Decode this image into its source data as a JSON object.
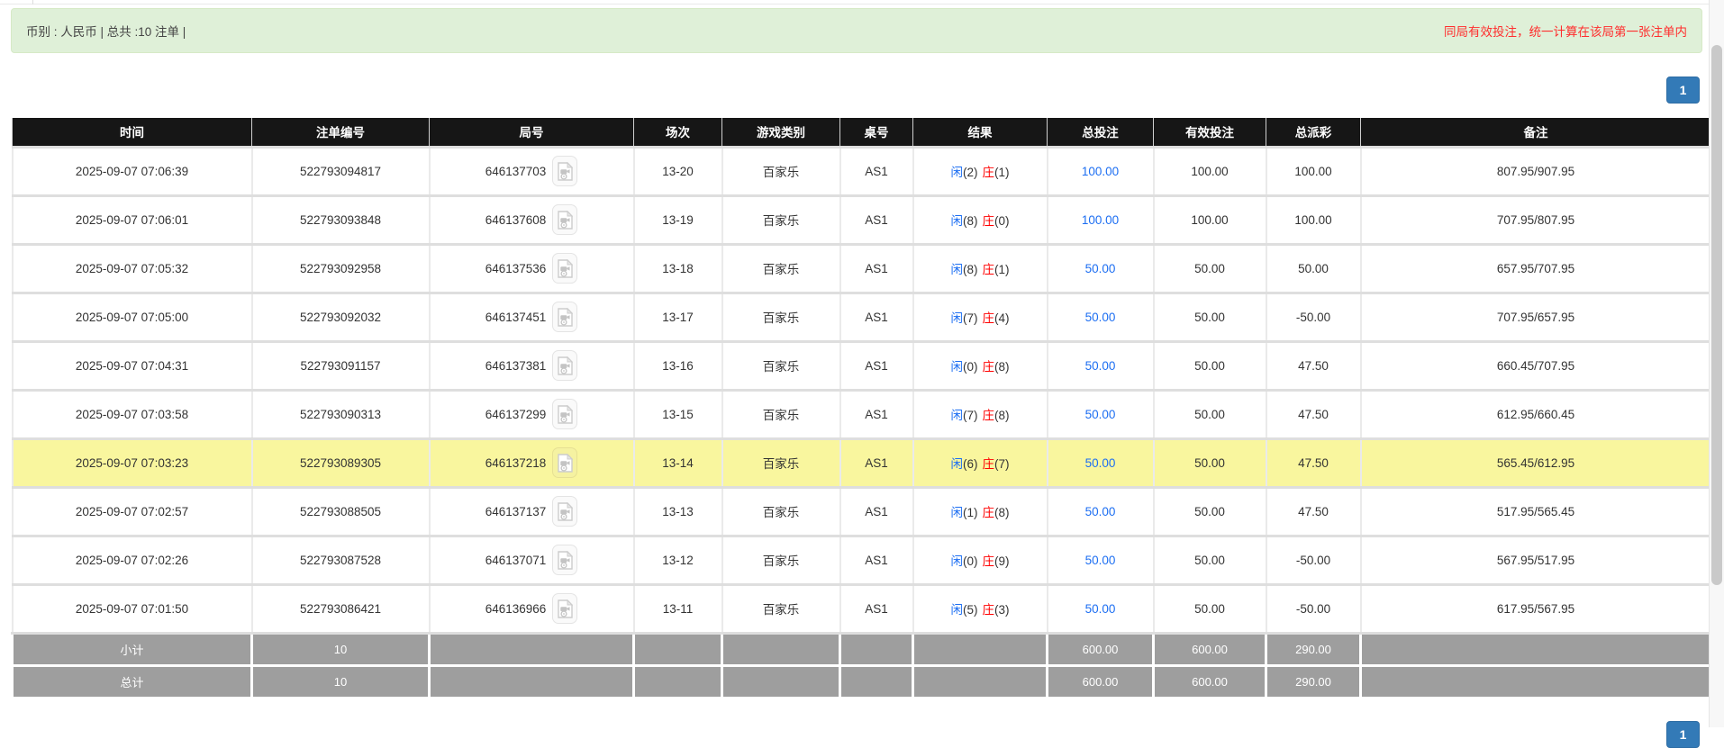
{
  "info_bar": {
    "left_text": "币别 : 人民币 | 总共 :10 注单 |",
    "right_notice": "同局有效投注，统一计算在该局第一张注单内"
  },
  "pagination": {
    "page_label": "1"
  },
  "table": {
    "headers": [
      "时间",
      "注单编号",
      "局号",
      "场次",
      "游戏类别",
      "桌号",
      "结果",
      "总投注",
      "有效投注",
      "总派彩",
      "备注"
    ],
    "rows": [
      {
        "time": "2025-09-07 07:06:39",
        "bet_no": "522793094817",
        "round_no": "646137703",
        "session": "13-20",
        "game": "百家乐",
        "table_no": "AS1",
        "player": "闲",
        "player_n": "(2)",
        "banker": "庄",
        "banker_n": "(1)",
        "total_bet": "100.00",
        "valid_bet": "100.00",
        "payout": "100.00",
        "remark": "807.95/907.95",
        "highlight": false
      },
      {
        "time": "2025-09-07 07:06:01",
        "bet_no": "522793093848",
        "round_no": "646137608",
        "session": "13-19",
        "game": "百家乐",
        "table_no": "AS1",
        "player": "闲",
        "player_n": "(8)",
        "banker": "庄",
        "banker_n": "(0)",
        "total_bet": "100.00",
        "valid_bet": "100.00",
        "payout": "100.00",
        "remark": "707.95/807.95",
        "highlight": false
      },
      {
        "time": "2025-09-07 07:05:32",
        "bet_no": "522793092958",
        "round_no": "646137536",
        "session": "13-18",
        "game": "百家乐",
        "table_no": "AS1",
        "player": "闲",
        "player_n": "(8)",
        "banker": "庄",
        "banker_n": "(1)",
        "total_bet": "50.00",
        "valid_bet": "50.00",
        "payout": "50.00",
        "remark": "657.95/707.95",
        "highlight": false
      },
      {
        "time": "2025-09-07 07:05:00",
        "bet_no": "522793092032",
        "round_no": "646137451",
        "session": "13-17",
        "game": "百家乐",
        "table_no": "AS1",
        "player": "闲",
        "player_n": "(7)",
        "banker": "庄",
        "banker_n": "(4)",
        "total_bet": "50.00",
        "valid_bet": "50.00",
        "payout": "-50.00",
        "remark": "707.95/657.95",
        "highlight": false
      },
      {
        "time": "2025-09-07 07:04:31",
        "bet_no": "522793091157",
        "round_no": "646137381",
        "session": "13-16",
        "game": "百家乐",
        "table_no": "AS1",
        "player": "闲",
        "player_n": "(0)",
        "banker": "庄",
        "banker_n": "(8)",
        "total_bet": "50.00",
        "valid_bet": "50.00",
        "payout": "47.50",
        "remark": "660.45/707.95",
        "highlight": false
      },
      {
        "time": "2025-09-07 07:03:58",
        "bet_no": "522793090313",
        "round_no": "646137299",
        "session": "13-15",
        "game": "百家乐",
        "table_no": "AS1",
        "player": "闲",
        "player_n": "(7)",
        "banker": "庄",
        "banker_n": "(8)",
        "total_bet": "50.00",
        "valid_bet": "50.00",
        "payout": "47.50",
        "remark": "612.95/660.45",
        "highlight": false
      },
      {
        "time": "2025-09-07 07:03:23",
        "bet_no": "522793089305",
        "round_no": "646137218",
        "session": "13-14",
        "game": "百家乐",
        "table_no": "AS1",
        "player": "闲",
        "player_n": "(6)",
        "banker": "庄",
        "banker_n": "(7)",
        "total_bet": "50.00",
        "valid_bet": "50.00",
        "payout": "47.50",
        "remark": "565.45/612.95",
        "highlight": true
      },
      {
        "time": "2025-09-07 07:02:57",
        "bet_no": "522793088505",
        "round_no": "646137137",
        "session": "13-13",
        "game": "百家乐",
        "table_no": "AS1",
        "player": "闲",
        "player_n": "(1)",
        "banker": "庄",
        "banker_n": "(8)",
        "total_bet": "50.00",
        "valid_bet": "50.00",
        "payout": "47.50",
        "remark": "517.95/565.45",
        "highlight": false
      },
      {
        "time": "2025-09-07 07:02:26",
        "bet_no": "522793087528",
        "round_no": "646137071",
        "session": "13-12",
        "game": "百家乐",
        "table_no": "AS1",
        "player": "闲",
        "player_n": "(0)",
        "banker": "庄",
        "banker_n": "(9)",
        "total_bet": "50.00",
        "valid_bet": "50.00",
        "payout": "-50.00",
        "remark": "567.95/517.95",
        "highlight": false
      },
      {
        "time": "2025-09-07 07:01:50",
        "bet_no": "522793086421",
        "round_no": "646136966",
        "session": "13-11",
        "game": "百家乐",
        "table_no": "AS1",
        "player": "闲",
        "player_n": "(5)",
        "banker": "庄",
        "banker_n": "(3)",
        "total_bet": "50.00",
        "valid_bet": "50.00",
        "payout": "-50.00",
        "remark": "617.95/567.95",
        "highlight": false
      }
    ],
    "subtotal": {
      "label": "小计",
      "count": "10",
      "total_bet": "600.00",
      "valid_bet": "600.00",
      "payout": "290.00"
    },
    "total": {
      "label": "总计",
      "count": "10",
      "total_bet": "600.00",
      "valid_bet": "600.00",
      "payout": "290.00"
    }
  },
  "icons": {
    "round_video_icon": "video-file-icon"
  },
  "colors": {
    "bar_green_bg": "#dff0d8",
    "bar_green_border": "#d6e9c6",
    "notice_red": "#ff2d2d",
    "header_black": "#161616",
    "link_blue": "#1c6ef2",
    "player_blue": "#1c6ef2",
    "banker_red": "#ff0000",
    "negative_red": "#ff0000",
    "highlight_yellow": "#f9f69e",
    "footer_gray": "#9e9e9e",
    "pagination_blue": "#337ab7"
  }
}
